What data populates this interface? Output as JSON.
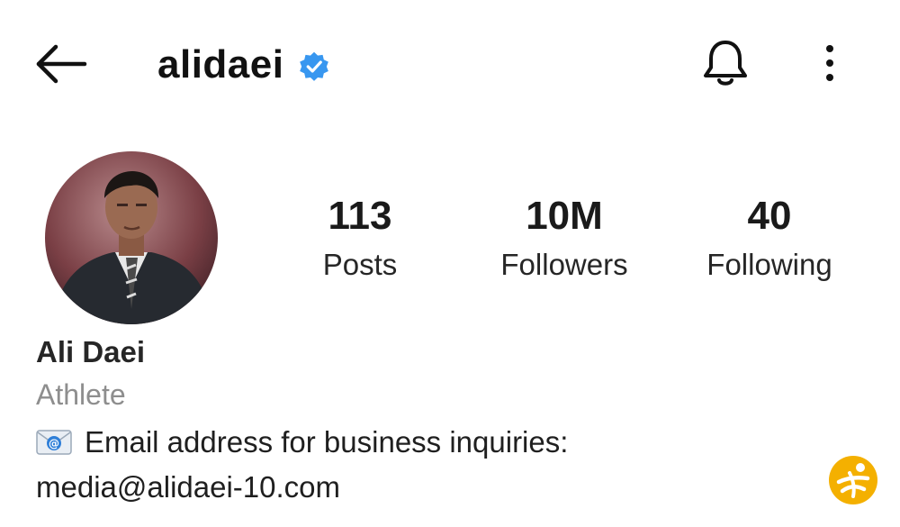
{
  "header": {
    "back_icon": "arrow-left-icon",
    "username": "alidaei",
    "verified_icon": "verified-badge-icon",
    "notifications_icon": "bell-icon",
    "more_icon": "more-vertical-icon",
    "verified_color": "#3897f0"
  },
  "stats": {
    "posts": {
      "value": "113",
      "label": "Posts"
    },
    "followers": {
      "value": "10M",
      "label": "Followers"
    },
    "following": {
      "value": "40",
      "label": "Following"
    }
  },
  "profile": {
    "name": "Ali Daei",
    "category": "Athlete",
    "bio_icon": "email-envelope-icon",
    "bio_text": "Email address for business inquiries:",
    "email": "media@alidaei-10.com"
  },
  "watermark": {
    "icon": "logo-watermark-icon",
    "color": "#f4b000"
  }
}
